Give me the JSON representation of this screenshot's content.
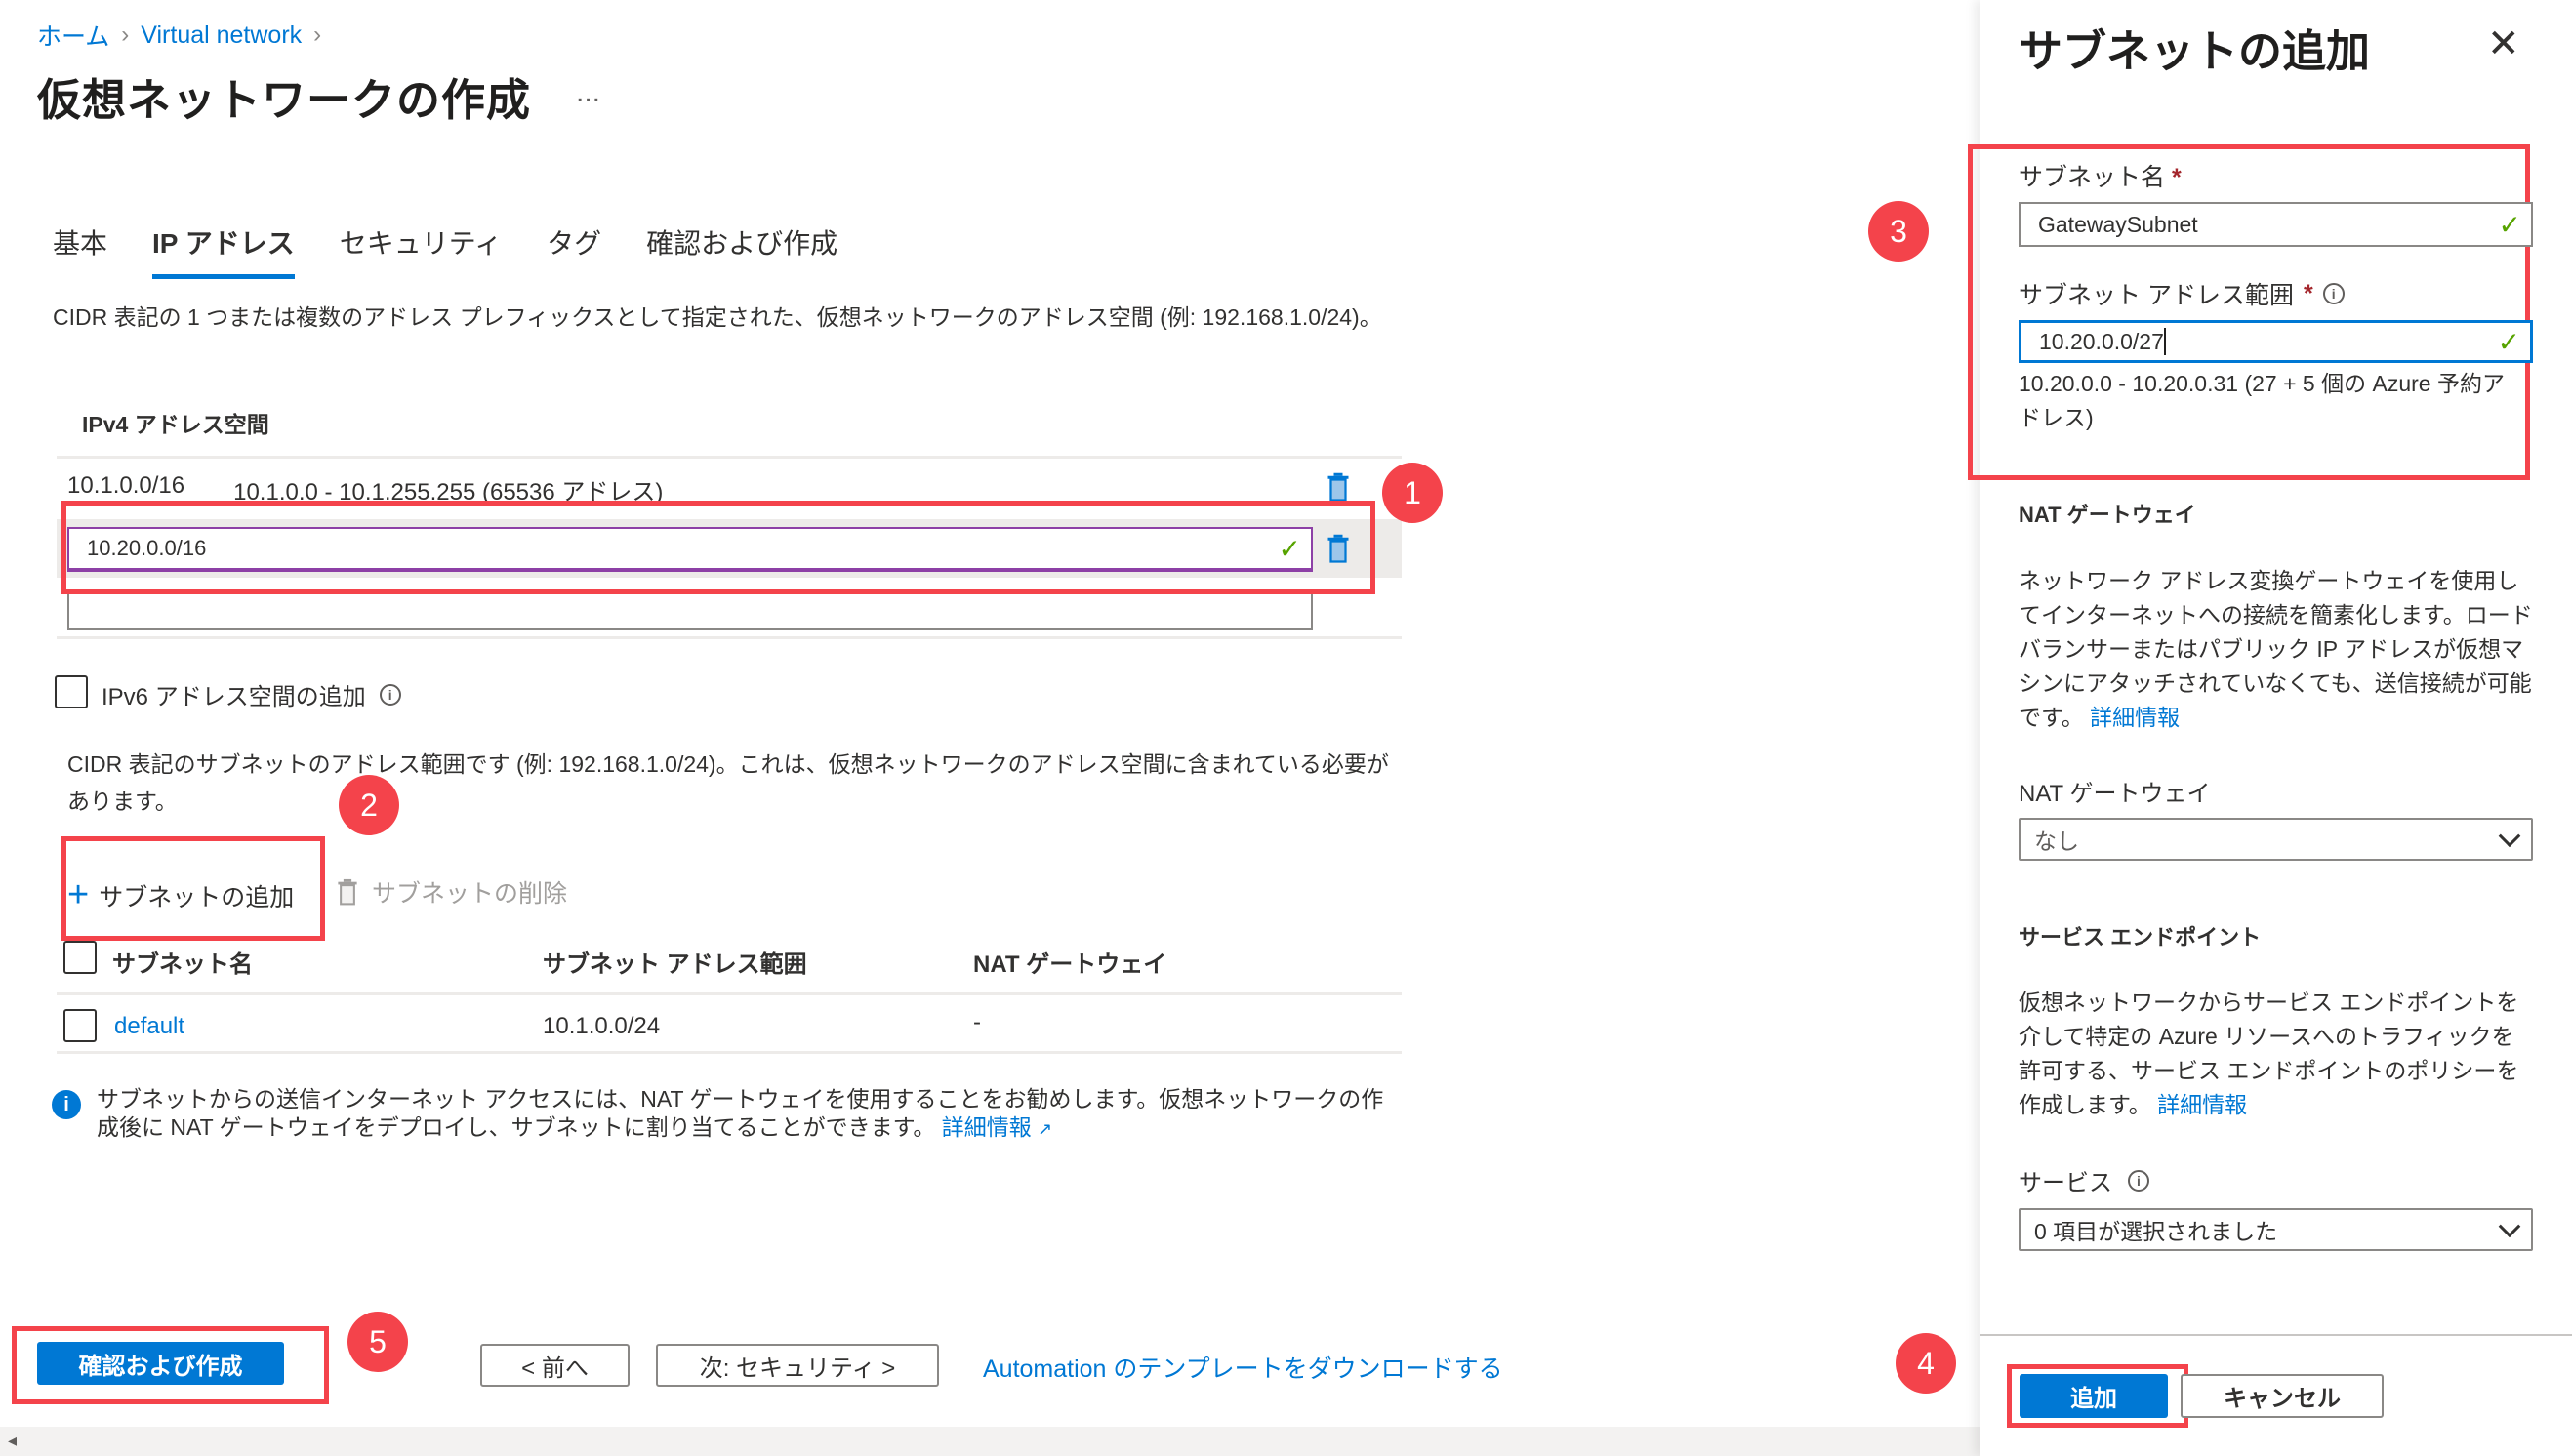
{
  "breadcrumb": [
    {
      "label": "ホーム"
    },
    {
      "label": "Virtual network"
    }
  ],
  "page_title": "仮想ネットワークの作成",
  "more_label": "...",
  "tabs": [
    {
      "label": "基本",
      "active": false
    },
    {
      "label": "IP アドレス",
      "active": true
    },
    {
      "label": "セキュリティ",
      "active": false
    },
    {
      "label": "タグ",
      "active": false
    },
    {
      "label": "確認および作成",
      "active": false
    }
  ],
  "address_space": {
    "description": "CIDR 表記の 1 つまたは複数のアドレス プレフィックスとして指定された、仮想ネットワークのアドレス空間 (例: 192.168.1.0/24)。",
    "header": "IPv4 アドレス空間",
    "existing": {
      "cidr": "10.1.0.0/16",
      "range": "10.1.0.0 - 10.1.255.255 (65536 アドレス)"
    },
    "new_input_value": "10.20.0.0/16",
    "empty_input_value": ""
  },
  "ipv6": {
    "label": "IPv6 アドレス空間の追加",
    "checked": false
  },
  "subnets": {
    "description": "CIDR 表記のサブネットのアドレス範囲です (例: 192.168.1.0/24)。これは、仮想ネットワークのアドレス空間に含まれている必要があります。",
    "add_label": "サブネットの追加",
    "delete_label": "サブネットの削除",
    "columns": [
      "サブネット名",
      "サブネット アドレス範囲",
      "NAT ゲートウェイ"
    ],
    "rows": [
      {
        "name": "default",
        "range": "10.1.0.0/24",
        "nat": "-"
      }
    ]
  },
  "info_message": {
    "text": "サブネットからの送信インターネット アクセスには、NAT ゲートウェイを使用することをお勧めします。仮想ネットワークの作成後に NAT ゲートウェイをデプロイし、サブネットに割り当てることができます。",
    "link": "詳細情報"
  },
  "footer": {
    "review_create": "確認および作成",
    "previous": "< 前へ",
    "next": "次: セキュリティ >",
    "download_template": "Automation のテンプレートをダウンロードする"
  },
  "panel": {
    "title": "サブネットの追加",
    "subnet_name_label": "サブネット名",
    "subnet_name_value": "GatewaySubnet",
    "address_range_label": "サブネット アドレス範囲",
    "address_range_value": "10.20.0.0/27",
    "address_range_hint": "10.20.0.0 - 10.20.0.31 (27 + 5 個の Azure 予約アドレス)",
    "required_marker": "*",
    "nat_section": "NAT ゲートウェイ",
    "nat_description": "ネットワーク アドレス変換ゲートウェイを使用してインターネットへの接続を簡素化します。ロード バランサーまたはパブリック IP アドレスが仮想マシンにアタッチされていなくても、送信接続が可能です。",
    "nat_link": "詳細情報",
    "nat_label": "NAT ゲートウェイ",
    "nat_value": "なし",
    "endpoint_section": "サービス エンドポイント",
    "endpoint_description": "仮想ネットワークからサービス エンドポイントを介して特定の Azure リソースへのトラフィックを許可する、サービス エンドポイントのポリシーを作成します。",
    "endpoint_link": "詳細情報",
    "services_label": "サービス",
    "services_value": "0 項目が選択されました",
    "add_button": "追加",
    "cancel_button": "キャンセル"
  },
  "annotations": [
    "1",
    "2",
    "3",
    "4",
    "5"
  ],
  "colors": {
    "accent": "#0078d4",
    "annotation": "#f4434b",
    "valid": "#57a300"
  }
}
